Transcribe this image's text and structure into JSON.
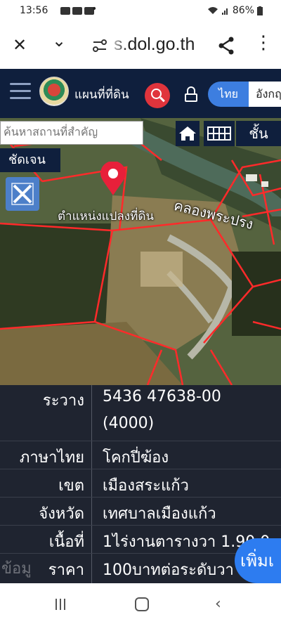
{
  "status_bar": {
    "time": "13:56",
    "dot": "•",
    "battery": "86%"
  },
  "browser": {
    "close_glyph": "✕",
    "chevron_glyph": "⌄",
    "url": "s.dol.go.th",
    "share_glyph": "⋖",
    "menu_glyph": "⋮"
  },
  "header": {
    "title": "แผนที่ที่ดิน",
    "lang_thai": "ไทย",
    "lang_english": "อังกฤ"
  },
  "map": {
    "search_placeholder": "ค้นหาสถานที่สำคัญ",
    "layer_label": "ชั้น",
    "clear_label": "ชัดเจน",
    "pin_label": "ตำแหน่งแปลงที่ดิน",
    "canal_label": "คลองพระปรง"
  },
  "info": {
    "rows": [
      {
        "label": "ระวาง",
        "value_line1": "5436 47638-00",
        "value_line2": "(4000)"
      },
      {
        "label": "ภาษาไทย",
        "value": "โคกปี่ฆ้อง"
      },
      {
        "label": "เขต",
        "value": "เมืองสระแก้ว"
      },
      {
        "label": "จังหวัด",
        "value": "เทศบาลเมืองแก้ว"
      },
      {
        "label": "เนื้อที่",
        "value": "1ไร่งานตารางวา 1.90.0"
      },
      {
        "label": "ราคา",
        "value": "100บาทต่อระดับวา"
      }
    ],
    "more_button": "เพิ่มเ",
    "ghost_button": "ข้อมู"
  },
  "colors": {
    "header_bg": "#0f1f3d",
    "accent_red": "#e0343c",
    "accent_blue": "#3d7ee0",
    "table_bg": "#1f2430"
  }
}
